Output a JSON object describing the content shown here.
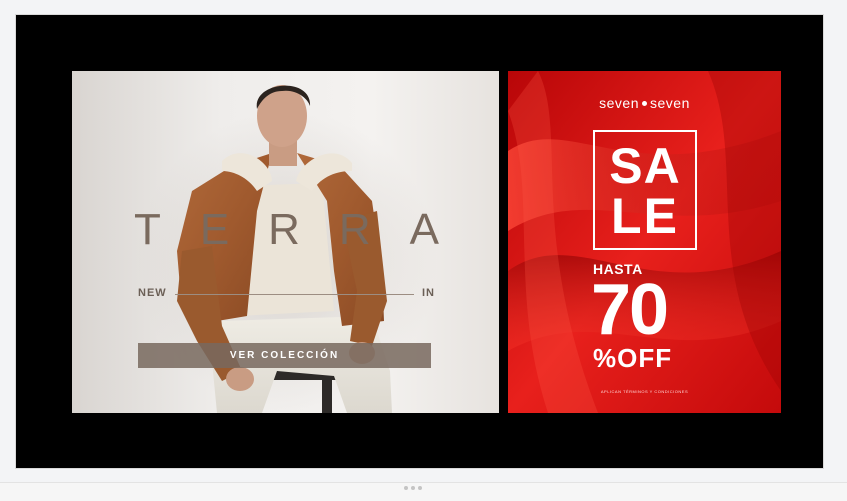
{
  "left_banner": {
    "title_letters": [
      "T",
      "E",
      "R",
      "R",
      "A"
    ],
    "new_label": "NEW",
    "in_label": "IN",
    "cta_label": "VER COLECCIÓN"
  },
  "right_banner": {
    "brand_left": "seven",
    "brand_right": "seven",
    "sale_line1": "SA",
    "sale_line2": "LE",
    "hasta": "HASTA",
    "percent": "70",
    "off": "%OFF",
    "fine_print": "APLICAN TÉRMINOS Y CONDICIONES"
  },
  "colors": {
    "frame": "#000000",
    "sale_red": "#d4100f",
    "terra_brown": "#7a6a5e",
    "cta_fill": "#78685e"
  }
}
